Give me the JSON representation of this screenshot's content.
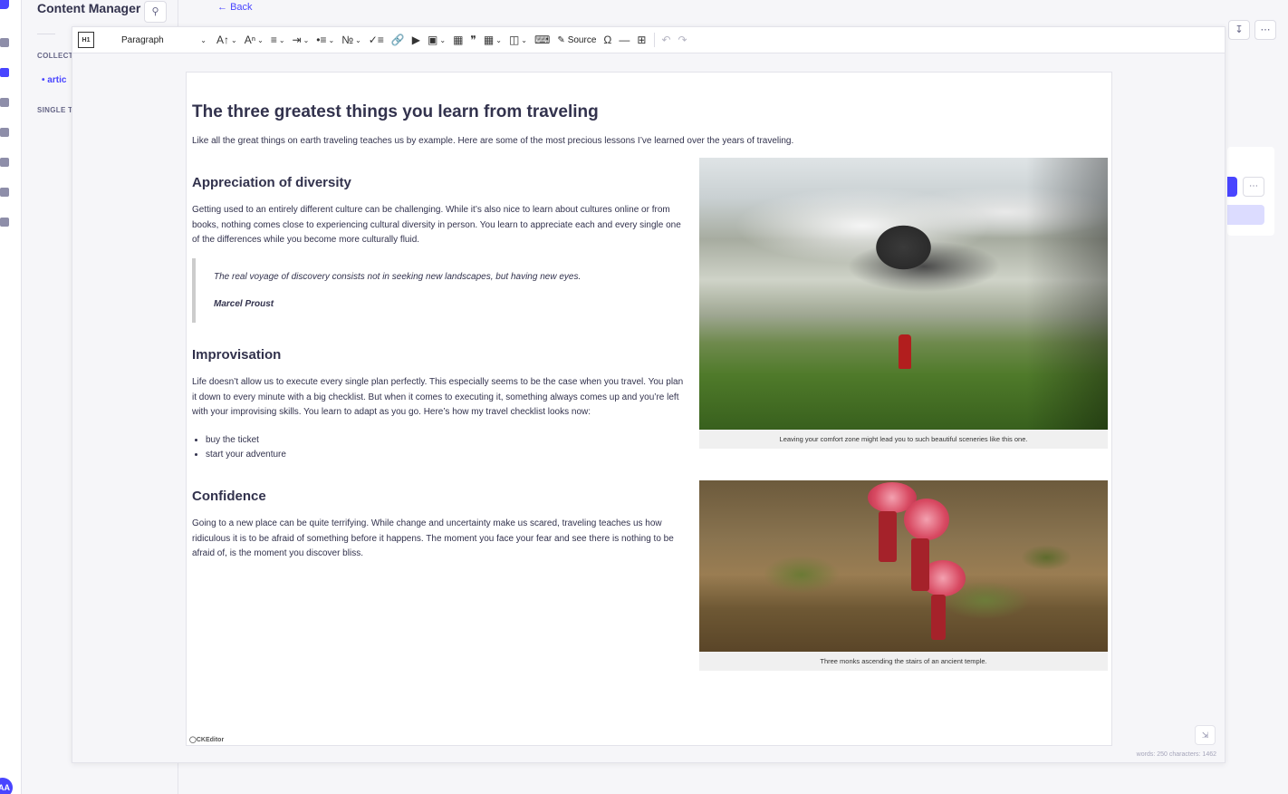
{
  "app": {
    "sidebar_title": "Content Manager",
    "collection_section": "COLLECTI",
    "collection_item": "artic",
    "single_section": "SINGLE TY",
    "avatar_initials": "AA",
    "back_label": "Back"
  },
  "toolbar": {
    "heading_icon": "H1",
    "paragraph_label": "Paragraph",
    "source_label": "Source",
    "icons": [
      "heading-icon",
      "font-size-icon",
      "font-family-icon",
      "align-icon",
      "indent-icon",
      "bulleted-list-icon",
      "numbered-list-icon",
      "todo-list-icon",
      "link-icon",
      "media-embed-icon",
      "insert-image-icon",
      "image-icon",
      "blockquote-icon",
      "table-icon",
      "html-embed-icon",
      "code-block-icon",
      "source-icon",
      "special-characters-icon",
      "horizontal-line-icon",
      "page-break-icon",
      "undo-icon",
      "redo-icon"
    ]
  },
  "document": {
    "title": "The three greatest things you learn from traveling",
    "intro": "Like all the great things on earth traveling teaches us by example. Here are some of the most precious lessons I’ve learned over the years of traveling.",
    "sections": [
      {
        "heading": "Appreciation of diversity",
        "body": "Getting used to an entirely different culture can be challenging. While it’s also nice to learn about cultures online or from books, nothing comes close to experiencing cultural diversity in person. You learn to appreciate each and every single one of the differences while you become more culturally fluid."
      },
      {
        "heading": "Improvisation",
        "body": "Life doesn’t allow us to execute every single plan perfectly. This especially seems to be the case when you travel. You plan it down to every minute with a big checklist. But when it comes to executing it, something always comes up and you’re left with your improvising skills. You learn to adapt as you go. Here’s how my travel checklist looks now:"
      },
      {
        "heading": "Confidence",
        "body": "Going to a new place can be quite terrifying. While change and uncertainty make us scared, traveling teaches us how ridiculous it is to be afraid of something before it happens. The moment you face your fear and see there is nothing to be afraid of, is the moment you discover bliss."
      }
    ],
    "quote": {
      "text": "The real voyage of discovery consists not in seeking new landscapes, but having new eyes.",
      "author": "Marcel Proust"
    },
    "checklist": [
      "buy the ticket",
      "start your adventure"
    ],
    "figures": [
      {
        "caption": "Leaving your comfort zone might lead you to such beautiful sceneries like this one."
      },
      {
        "caption": "Three monks ascending the stairs of an ancient temple."
      }
    ]
  },
  "footer": {
    "brand": "CKEditor",
    "word_count": "words: 250 characters: 1462"
  }
}
